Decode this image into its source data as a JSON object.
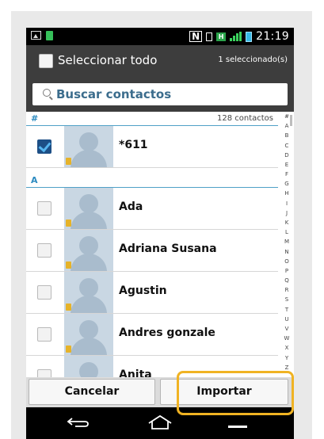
{
  "status_bar": {
    "time": "21:19",
    "nfc_label": "N",
    "network_label": "H",
    "icons": [
      "image-icon",
      "sd-card-icon",
      "nfc-icon",
      "vibrate-icon",
      "network-h-icon",
      "signal-icon",
      "battery-icon"
    ]
  },
  "header": {
    "select_all_label": "Seleccionar todo",
    "selected_count": "1 seleccionado(s)"
  },
  "search": {
    "placeholder": "Buscar contactos"
  },
  "list": {
    "section_hash": {
      "letter": "#",
      "count": "128 contactos"
    },
    "section_a": {
      "letter": "A"
    },
    "contacts": [
      {
        "name": "*611",
        "checked": true
      },
      {
        "name": "Ada",
        "checked": false
      },
      {
        "name": "Adriana Susana",
        "checked": false
      },
      {
        "name": "Agustin",
        "checked": false
      },
      {
        "name": "Andres gonzale",
        "checked": false
      },
      {
        "name": "Anita",
        "checked": false
      }
    ]
  },
  "index_bar": [
    "#",
    "A",
    "B",
    "C",
    "D",
    "E",
    "F",
    "G",
    "H",
    "I",
    "J",
    "K",
    "L",
    "M",
    "N",
    "O",
    "P",
    "Q",
    "R",
    "S",
    "T",
    "U",
    "V",
    "W",
    "X",
    "Y",
    "Z"
  ],
  "buttons": {
    "cancel": "Cancelar",
    "import": "Importar"
  },
  "colors": {
    "header_bg": "#3d3d3d",
    "accent_blue": "#2b8ac0",
    "highlight_orange": "#f0b323",
    "checkbox_checked": "#1d4f86"
  }
}
